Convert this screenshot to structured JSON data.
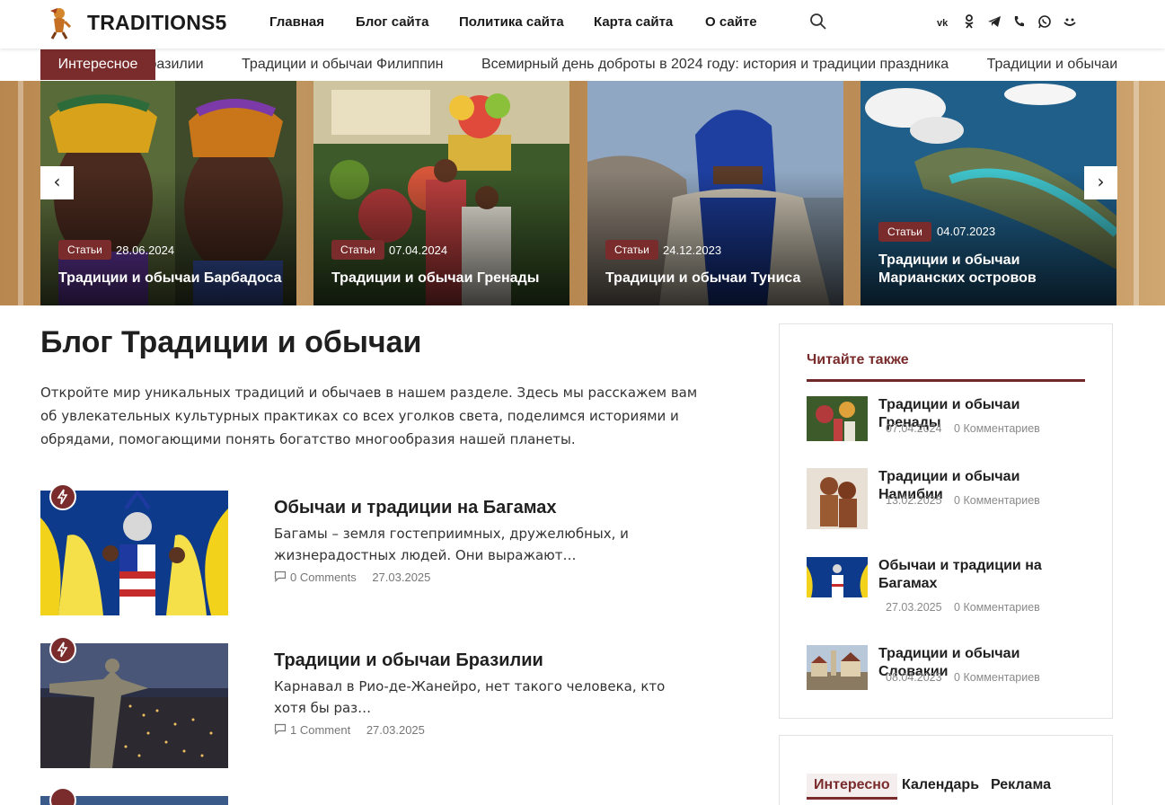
{
  "header": {
    "site_name": "TRADITIONS5",
    "nav": [
      "Главная",
      "Блог сайта",
      "Политика сайта",
      "Карта сайта",
      "О сайте"
    ],
    "social_icons": [
      "vk-icon",
      "odnoklassniki-icon",
      "telegram-icon",
      "viber-icon",
      "whatsapp-icon",
      "mail-icon"
    ]
  },
  "ticker": {
    "label": "Интересное",
    "items": [
      "Традиции и обычаи Бразилии",
      "Традиции и обычаи Филиппин",
      "Всемирный день доброты в 2024 году: история и традиции праздника",
      "Традиции и обычаи Барбадоса"
    ]
  },
  "slider": {
    "prev": "‹",
    "next": "›",
    "slides": [
      {
        "badge": "Статьи",
        "date": "28.06.2024",
        "title": "Традиции и обычаи Барбадоса"
      },
      {
        "badge": "Статьи",
        "date": "07.04.2024",
        "title": "Традиции и обычаи Гренады"
      },
      {
        "badge": "Статьи",
        "date": "24.12.2023",
        "title": "Традиции и обычаи Туниса"
      },
      {
        "badge": "Статьи",
        "date": "04.07.2023",
        "title": "Традиции и обычаи Марианских островов"
      }
    ]
  },
  "main": {
    "title": "Блог Традиции и обычаи",
    "intro": "Откройте мир уникальных традиций и обычаев в нашем разделе. Здесь мы расскажем вам об увлекательных культурных практиках со всех уголков света, поделимся историями и обрядами, помогающими понять богатство многообразия нашей планеты.",
    "posts": [
      {
        "title": "Обычаи и традиции на Багамах",
        "excerpt": "Багамы – земля гостеприимных, дружелюбных, и жизнерадостных людей. Они выражают…",
        "comments": "0 Comments",
        "date": "27.03.2025"
      },
      {
        "title": "Традиции и обычаи Бразилии",
        "excerpt": "Карнавал в Рио-де-Жанейро, нет такого человека, кто хотя бы раз…",
        "comments": "1 Comment",
        "date": "27.03.2025"
      }
    ]
  },
  "sidebar": {
    "title": "Читайте также",
    "items": [
      {
        "title": "Традиции и обычаи Гренады",
        "date": "07.04.2024",
        "comments": "0 Комментариев"
      },
      {
        "title": "Традиции и обычаи Намибии",
        "date": "13.02.2025",
        "comments": "0 Комментариев"
      },
      {
        "title": "Обычаи и традиции на Багамах",
        "date": "27.03.2025",
        "comments": "0 Комментариев"
      },
      {
        "title": "Традиции и обычаи Словакии",
        "date": "08.04.2023",
        "comments": "0 Комментариев"
      }
    ],
    "tabs": [
      "Интересно",
      "Календарь",
      "Реклама"
    ]
  },
  "colors": {
    "accent": "#7a2b2b"
  }
}
